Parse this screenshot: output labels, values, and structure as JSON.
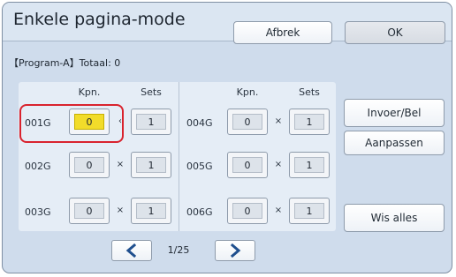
{
  "header": {
    "title": "Enkele pagina-mode",
    "cancel_label": "Afbrek",
    "ok_label": "OK"
  },
  "program": {
    "label": "【Program-A】Totaal: 0"
  },
  "columns": {
    "copies": "Kpn.",
    "sets": "Sets"
  },
  "groups": [
    {
      "id": "001G",
      "copies": "0",
      "sets": "1",
      "active": true
    },
    {
      "id": "002G",
      "copies": "0",
      "sets": "1"
    },
    {
      "id": "003G",
      "copies": "0",
      "sets": "1"
    },
    {
      "id": "004G",
      "copies": "0",
      "sets": "1"
    },
    {
      "id": "005G",
      "copies": "0",
      "sets": "1"
    },
    {
      "id": "006G",
      "copies": "0",
      "sets": "1"
    }
  ],
  "side_buttons": {
    "entry": "Invoer/Bel",
    "adjust": "Aanpassen",
    "clear_all": "Wis alles"
  },
  "pagination": {
    "page": "1/25",
    "prev_icon": "chevron-left-icon",
    "next_icon": "chevron-right-icon"
  },
  "colors": {
    "accent_arrow": "#1f4f8e",
    "active_field": "#f2dc2a",
    "highlight_border": "#d9232e"
  }
}
